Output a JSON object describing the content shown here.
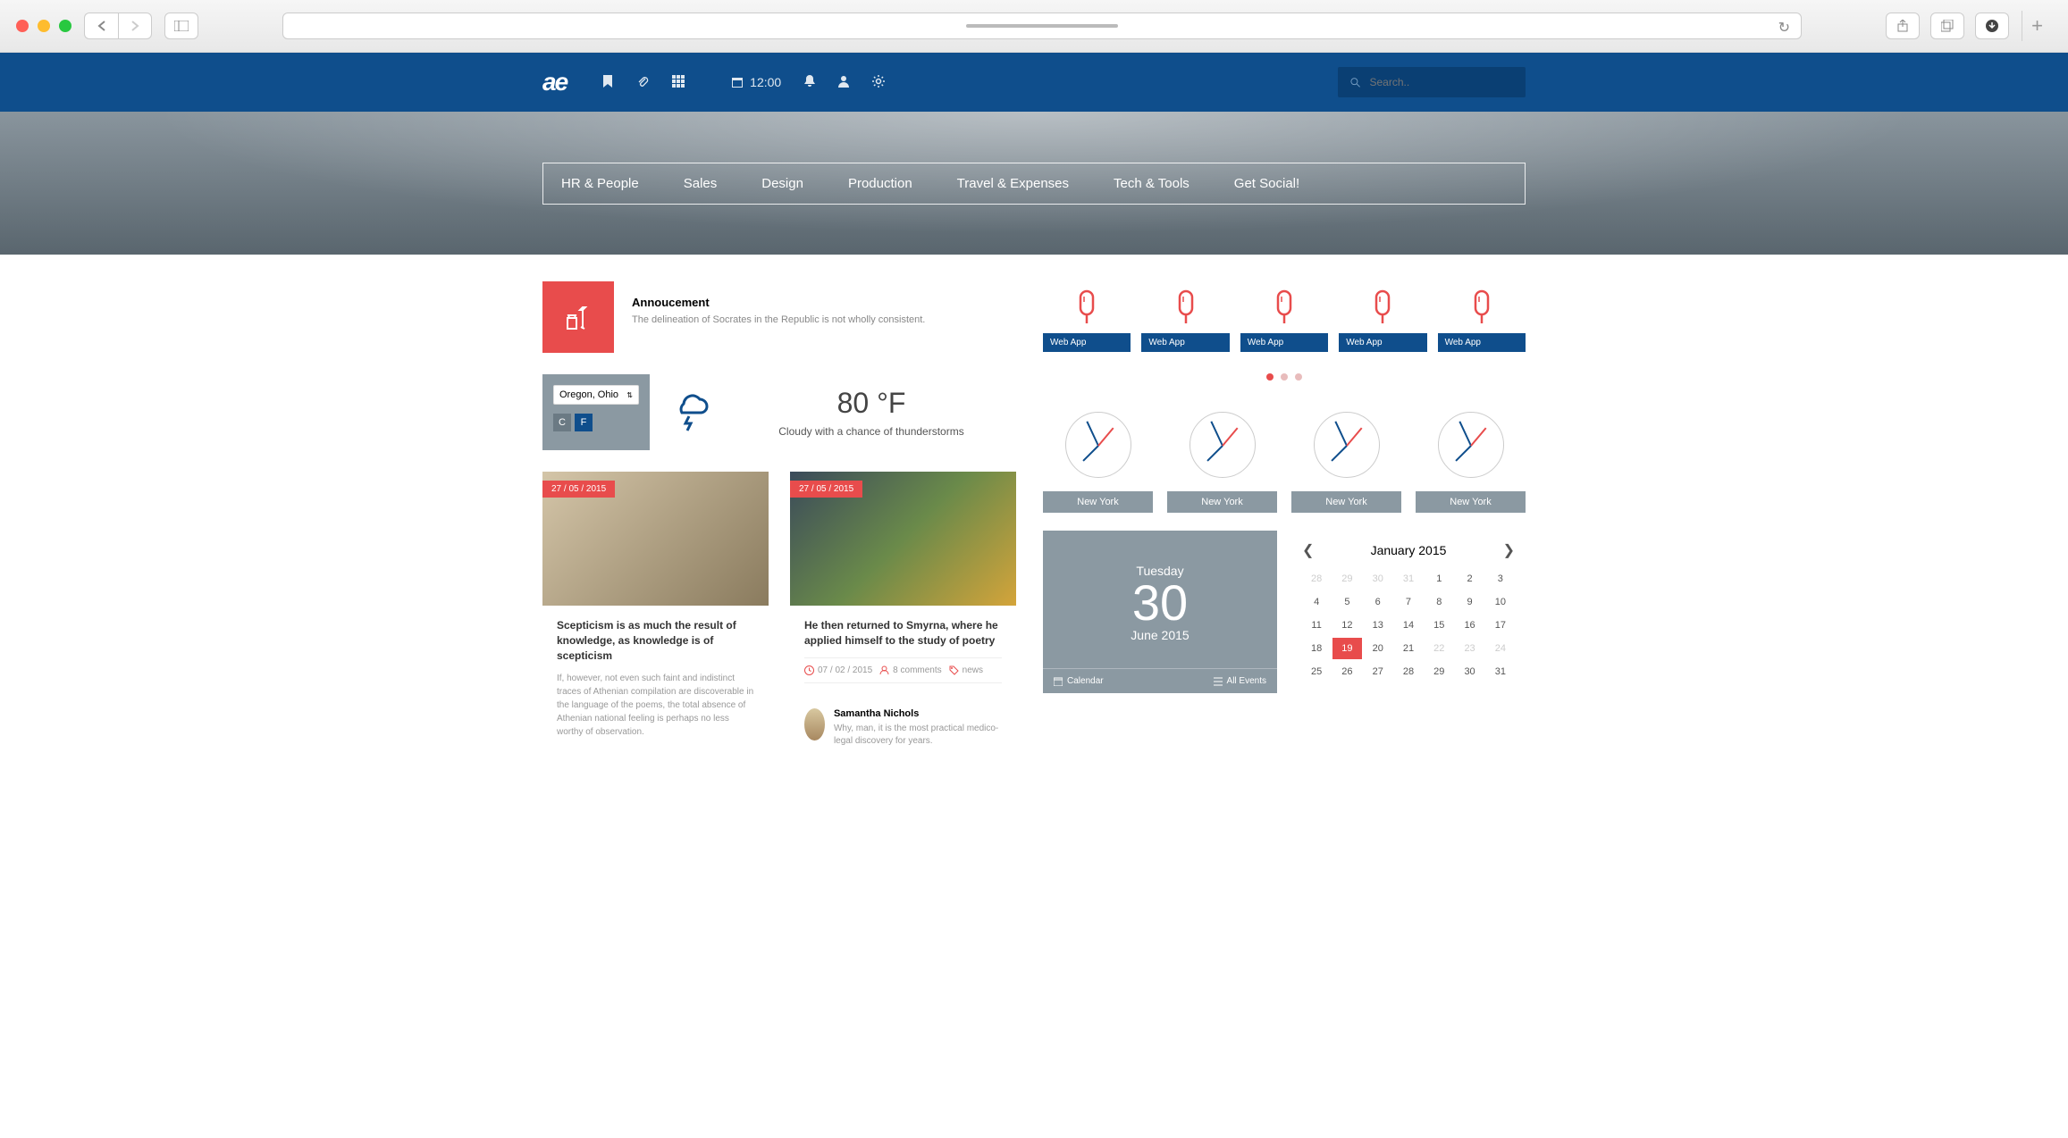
{
  "browser": {
    "url_placeholder": ""
  },
  "header": {
    "logo": "ae",
    "time": "12:00",
    "search_placeholder": "Search.."
  },
  "nav": {
    "items": [
      "HR & People",
      "Sales",
      "Design",
      "Production",
      "Travel & Expenses",
      "Tech & Tools",
      "Get Social!"
    ]
  },
  "announcement": {
    "title": "Annoucement",
    "text": "The delineation of Socrates in the Republic is not wholly consistent."
  },
  "weather": {
    "location": "Oregon, Ohio",
    "unit_c": "C",
    "unit_f": "F",
    "temp": "80 °F",
    "desc": "Cloudy with a chance of thunderstorms"
  },
  "news": {
    "card1": {
      "date": "27 / 05 / 2015",
      "title": "Scepticism is as much the result of knowledge, as knowledge is of scepticism",
      "excerpt": "If, however, not even such faint and indistinct traces of Athenian compilation are discoverable in the language of the poems, the total absence of Athenian national feeling is perhaps no less worthy of observation."
    },
    "card2": {
      "date": "27 / 05 / 2015",
      "title": "He then returned to Smyrna, where he applied himself to the study of poetry",
      "meta_date": "07 / 02 / 2015",
      "meta_comments": "8 comments",
      "meta_tag": "news",
      "comment_author": "Samantha Nichols",
      "comment_text": "Why, man, it is the most practical medico-legal discovery for years."
    }
  },
  "app_tiles": {
    "labels": [
      "Web App",
      "Web App",
      "Web App",
      "Web App",
      "Web App"
    ]
  },
  "clocks": {
    "labels": [
      "New York",
      "New York",
      "New York",
      "New York"
    ]
  },
  "calendar": {
    "today_day": "Tuesday",
    "today_num": "30",
    "today_month": "June 2015",
    "footer_left": "Calendar",
    "footer_right": "All Events",
    "mini_title": "January 2015",
    "cells": [
      {
        "v": "28",
        "m": true
      },
      {
        "v": "29",
        "m": true
      },
      {
        "v": "30",
        "m": true
      },
      {
        "v": "31",
        "m": true
      },
      {
        "v": "1"
      },
      {
        "v": "2"
      },
      {
        "v": "3"
      },
      {
        "v": "4"
      },
      {
        "v": "5"
      },
      {
        "v": "6"
      },
      {
        "v": "7"
      },
      {
        "v": "8"
      },
      {
        "v": "9"
      },
      {
        "v": "10"
      },
      {
        "v": "11"
      },
      {
        "v": "12"
      },
      {
        "v": "13"
      },
      {
        "v": "14"
      },
      {
        "v": "15"
      },
      {
        "v": "16"
      },
      {
        "v": "17"
      },
      {
        "v": "18"
      },
      {
        "v": "19",
        "t": true
      },
      {
        "v": "20"
      },
      {
        "v": "21"
      },
      {
        "v": "22",
        "m": true
      },
      {
        "v": "23",
        "m": true
      },
      {
        "v": "24",
        "m": true
      },
      {
        "v": "25"
      },
      {
        "v": "26"
      },
      {
        "v": "27"
      },
      {
        "v": "28"
      },
      {
        "v": "29"
      },
      {
        "v": "30"
      },
      {
        "v": "31"
      }
    ]
  }
}
